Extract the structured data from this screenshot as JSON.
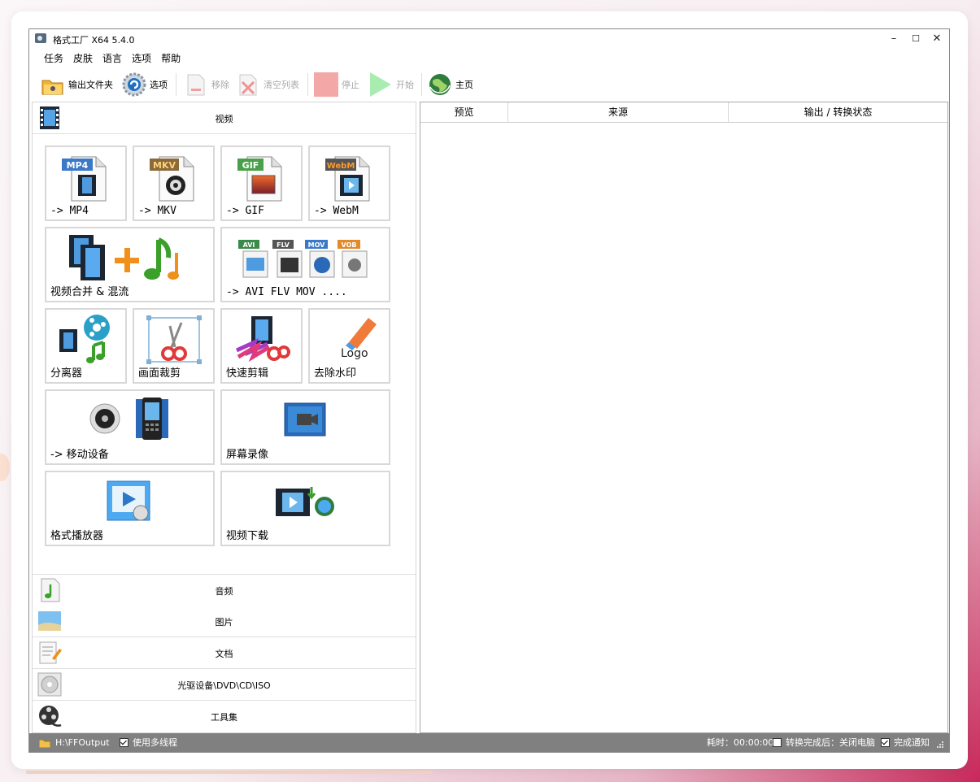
{
  "window": {
    "title": "格式工厂 X64 5.4.0",
    "controls": {
      "minimize": "–",
      "maximize": "☐",
      "close": "✕"
    }
  },
  "menu": [
    "任务",
    "皮肤",
    "语言",
    "选项",
    "帮助"
  ],
  "toolbar": {
    "output_folder": "输出文件夹",
    "options": "选项",
    "remove": "移除",
    "clear_list": "清空列表",
    "stop": "停止",
    "start": "开始",
    "home": "主页"
  },
  "categories": {
    "video": "视频",
    "audio": "音频",
    "image": "图片",
    "document": "文档",
    "disc": "光驱设备\\DVD\\CD\\ISO",
    "tools": "工具集"
  },
  "video_tiles": {
    "mp4": {
      "badge": "MP4",
      "label": "-> MP4"
    },
    "mkv": {
      "badge": "MKV",
      "label": "-> MKV"
    },
    "gif": {
      "badge": "GIF",
      "label": "-> GIF"
    },
    "webm": {
      "badge": "WebM",
      "label": "-> WebM"
    },
    "merge": {
      "label": "视频合并 & 混流"
    },
    "multi": {
      "badges": [
        "AVI",
        "FLV",
        "MOV",
        "VOB"
      ],
      "label": "-> AVI FLV MOV ...."
    },
    "splitter": {
      "label": "分离器"
    },
    "crop": {
      "label": "画面裁剪"
    },
    "quick_edit": {
      "label": "快速剪辑"
    },
    "logo": {
      "label": "去除水印",
      "icon_text": "Logo"
    },
    "mobile": {
      "label": "-> 移动设备"
    },
    "screen_record": {
      "label": "屏幕录像"
    },
    "player": {
      "label": "格式播放器"
    },
    "download": {
      "label": "视频下载"
    }
  },
  "table": {
    "columns": [
      "预览",
      "来源",
      "输出 / 转换状态"
    ]
  },
  "status": {
    "output_path": "H:\\FFOutput",
    "multithread": "使用多线程",
    "multithread_checked": true,
    "elapsed": "耗时：00:00:00",
    "after_done": "转换完成后：关闭电脑",
    "after_done_checked": false,
    "notify": "完成通知",
    "notify_checked": true
  }
}
